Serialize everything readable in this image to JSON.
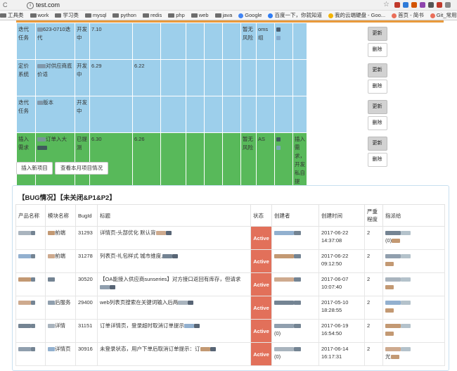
{
  "browser": {
    "url": "test.com",
    "bookmarks": [
      {
        "label": "工具类",
        "kind": "folder"
      },
      {
        "label": "work",
        "kind": "folder"
      },
      {
        "label": "学习类",
        "kind": "folder"
      },
      {
        "label": "mysql",
        "kind": "folder"
      },
      {
        "label": "python",
        "kind": "folder"
      },
      {
        "label": "redis",
        "kind": "folder"
      },
      {
        "label": "php",
        "kind": "folder"
      },
      {
        "label": "web",
        "kind": "folder"
      },
      {
        "label": "java",
        "kind": "folder"
      },
      {
        "label": "Google",
        "kind": "site",
        "color": "#4285f4"
      },
      {
        "label": "百度一下，你就知道",
        "kind": "site",
        "color": "#2e7df5"
      },
      {
        "label": "我的云端硬盘 - Goo...",
        "kind": "site",
        "color": "#f4b400"
      },
      {
        "label": "首页 - 简书",
        "kind": "site",
        "color": "#ea6f5a"
      },
      {
        "label": "Git_常用命令 - 简书",
        "kind": "site",
        "color": "#ea6f5a"
      }
    ]
  },
  "projects": {
    "update_label": "更新",
    "delete_label": "删除",
    "rows": [
      {
        "color": "blue",
        "type": "迭代任务",
        "name": "623-0710迭代",
        "status": "开发中",
        "d1": "7.10",
        "d2": "",
        "risk": "暂无风险",
        "team": "oms组",
        "note": ""
      },
      {
        "color": "blue",
        "type": "定价系统",
        "name": "对供应商底价适",
        "status": "开发中",
        "d1": "6.29",
        "d2": "6.22",
        "risk": "",
        "team": "",
        "note": ""
      },
      {
        "color": "blue",
        "type": "迭代任务",
        "name": "版本",
        "status": "开发中",
        "d1": "",
        "d2": "",
        "risk": "",
        "team": "",
        "note": ""
      },
      {
        "color": "green",
        "type": "插入需求",
        "name": "订单入大",
        "status": "已提测",
        "d1": "6.30",
        "d2": "6.26",
        "risk": "暂无风险",
        "team": "AS",
        "note": "插入需求，开发私自提交，测试未知"
      }
    ]
  },
  "controls": {
    "insert_project": "插入新项目",
    "view_month": "查看本月项目情况"
  },
  "bug_panel": {
    "title": "【BUG情况】【未关闭&P1&P2】",
    "headers": [
      "产品名称",
      "模块名称",
      "BugId",
      "标题",
      "状态",
      "创建者",
      "创建时间",
      "严重程度",
      "指派给"
    ],
    "rows": [
      {
        "module": "前端",
        "id": "31293",
        "title": "详情页-头部优化 默认背",
        "state": "Active",
        "creator": "",
        "date": "2017-06-22",
        "time": "14:37:08",
        "severity": "2",
        "assignee": "(0)"
      },
      {
        "module": "前端",
        "id": "31278",
        "title": "列表页-礼包样式 城市维度,",
        "state": "Active",
        "creator": "",
        "date": "2017-06-22",
        "time": "09:12:50",
        "severity": "2",
        "assignee": ""
      },
      {
        "module": "",
        "id": "30520",
        "title": "【OA能接入供应商sunseries】对方接口返回有库存，但请求",
        "state": "Active",
        "creator": "",
        "date": "2017-06-07",
        "time": "10:07:40",
        "severity": "2",
        "assignee": ""
      },
      {
        "module": "后服务",
        "id": "29400",
        "title": "web列表页搜索在关键词输入后两",
        "state": "Active",
        "creator": "",
        "date": "2017-05-10",
        "time": "18:28:55",
        "severity": "2",
        "assignee": ""
      },
      {
        "module": "详情",
        "id": "31151",
        "title": "订单详情页，登录超时取消订单提示",
        "state": "Active",
        "creator": "(0)",
        "date": "2017-06-19",
        "time": "16:54:50",
        "severity": "2",
        "assignee": ""
      },
      {
        "module": "详情页",
        "id": "30916",
        "title": "未登录状态，用户下单后取消订单提示：订",
        "state": "Active",
        "creator": "(0)",
        "date": "2017-06-14",
        "time": "16:17:31",
        "severity": "2",
        "assignee": "光"
      }
    ]
  }
}
